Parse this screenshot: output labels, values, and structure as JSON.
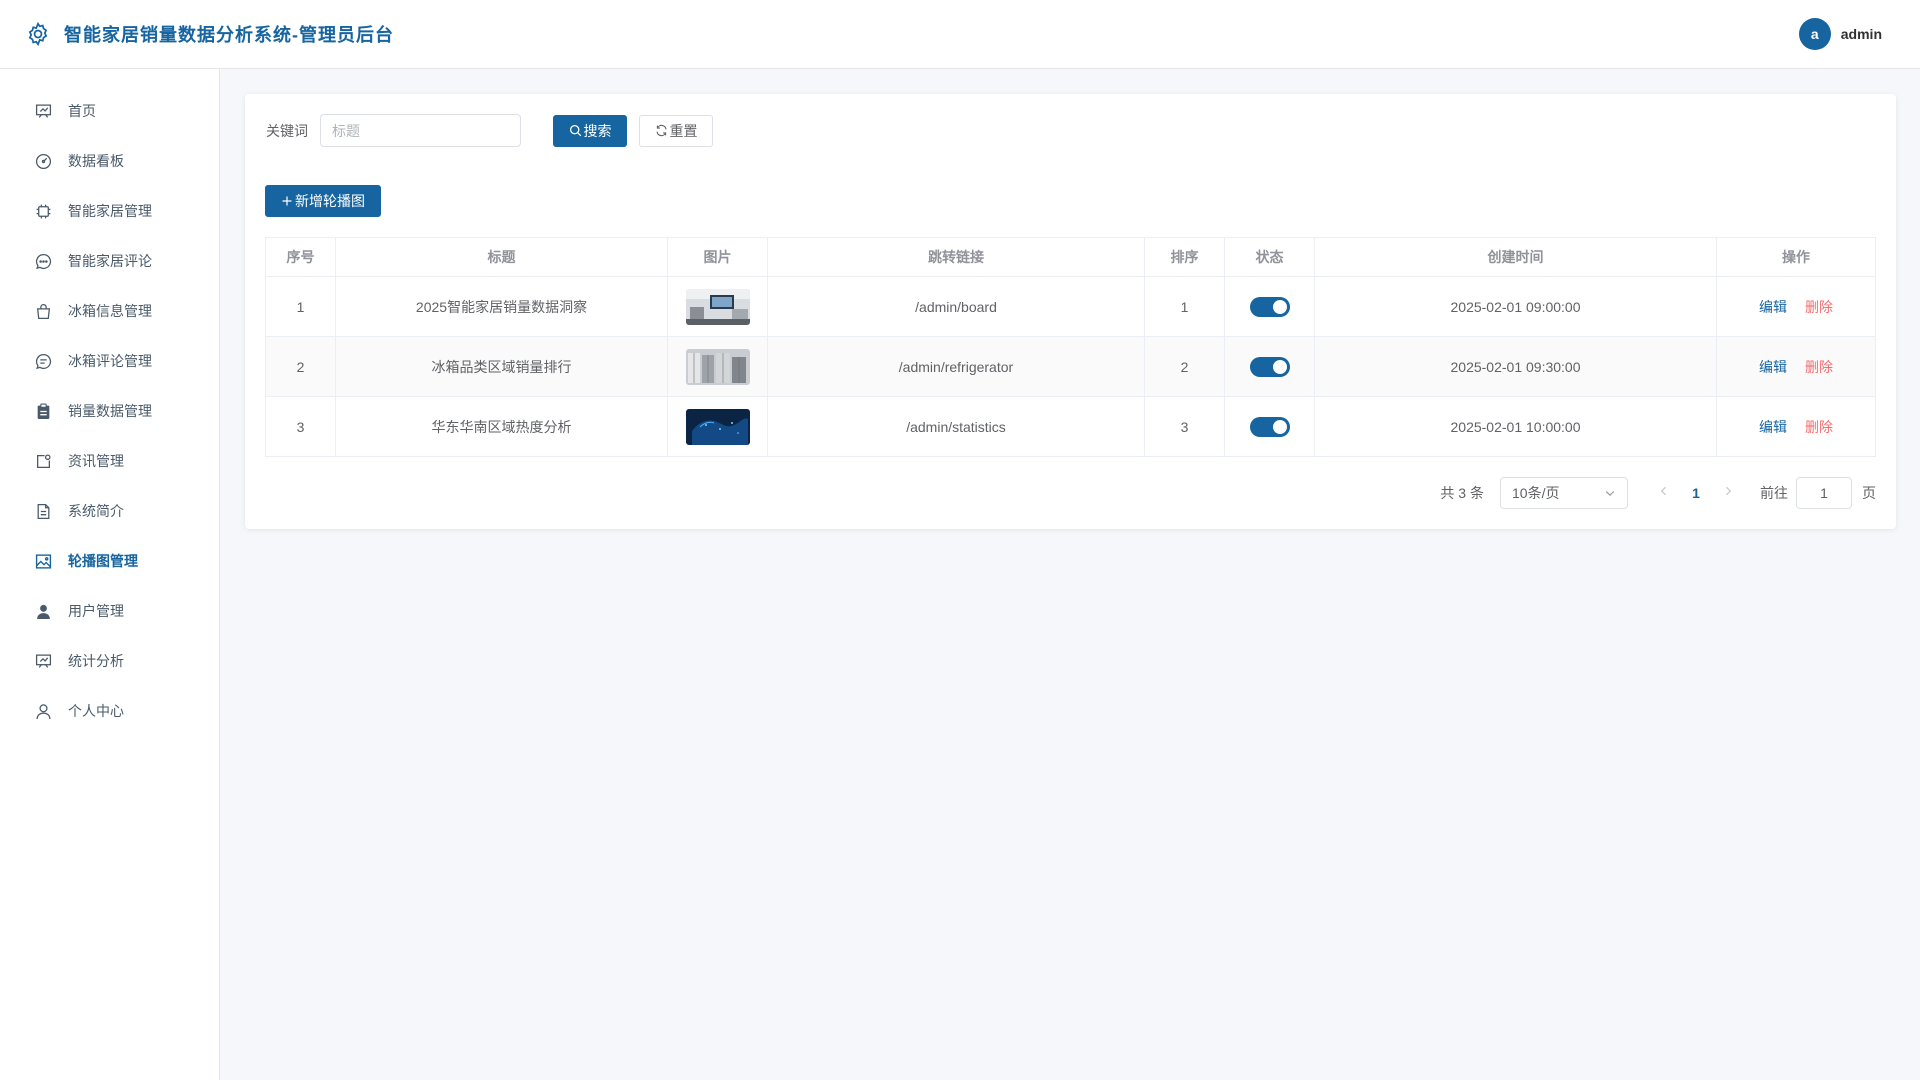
{
  "header": {
    "title": "智能家居销量数据分析系统-管理员后台",
    "avatar_letter": "a",
    "username": "admin"
  },
  "sidebar": {
    "items": [
      {
        "label": "首页",
        "icon": "presentation-icon"
      },
      {
        "label": "数据看板",
        "icon": "odometer-icon"
      },
      {
        "label": "智能家居管理",
        "icon": "cpu-icon"
      },
      {
        "label": "智能家居评论",
        "icon": "chat-dots-icon"
      },
      {
        "label": "冰箱信息管理",
        "icon": "shopping-bag-icon"
      },
      {
        "label": "冰箱评论管理",
        "icon": "chat-line-icon"
      },
      {
        "label": "销量数据管理",
        "icon": "clipboard-icon"
      },
      {
        "label": "资讯管理",
        "icon": "notification-icon"
      },
      {
        "label": "系统简介",
        "icon": "document-icon"
      },
      {
        "label": "轮播图管理",
        "icon": "picture-icon",
        "active": true
      },
      {
        "label": "用户管理",
        "icon": "user-filled-icon"
      },
      {
        "label": "统计分析",
        "icon": "data-board-icon"
      },
      {
        "label": "个人中心",
        "icon": "user-icon"
      }
    ]
  },
  "search": {
    "label": "关键词",
    "placeholder": "标题",
    "search_button": "搜索",
    "reset_button": "重置"
  },
  "add_button": "新增轮播图",
  "table": {
    "columns": [
      "序号",
      "标题",
      "图片",
      "跳转链接",
      "排序",
      "状态",
      "创建时间",
      "操作"
    ],
    "rows": [
      {
        "index": "1",
        "title": "2025智能家居销量数据洞察",
        "link": "/admin/board",
        "sort": "1",
        "enabled": true,
        "created": "2025-02-01 09:00:00",
        "edit": "编辑",
        "delete": "删除"
      },
      {
        "index": "2",
        "title": "冰箱品类区域销量排行",
        "link": "/admin/refrigerator",
        "sort": "2",
        "enabled": true,
        "created": "2025-02-01 09:30:00",
        "edit": "编辑",
        "delete": "删除"
      },
      {
        "index": "3",
        "title": "华东华南区域热度分析",
        "link": "/admin/statistics",
        "sort": "3",
        "enabled": true,
        "created": "2025-02-01 10:00:00",
        "edit": "编辑",
        "delete": "删除"
      }
    ]
  },
  "pagination": {
    "total": "共 3 条",
    "page_size": "10条/页",
    "current_page": "1",
    "goto_label": "前往",
    "goto_value": "1",
    "goto_suffix": "页"
  },
  "colors": {
    "primary": "#1664a0",
    "danger": "#f56c6c",
    "background": "#f5f7fa"
  }
}
